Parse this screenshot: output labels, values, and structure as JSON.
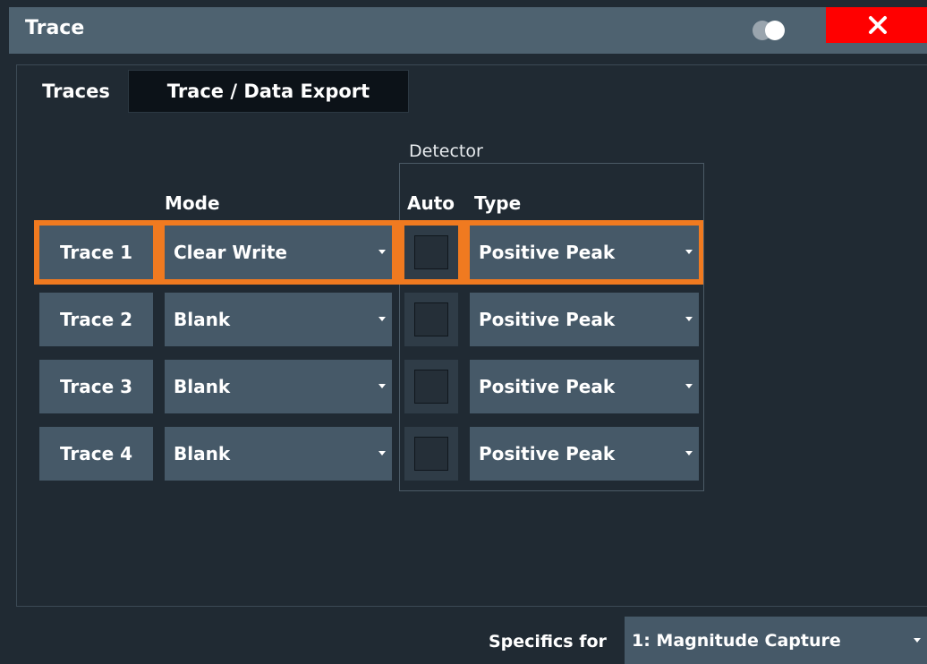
{
  "window": {
    "title": "Trace"
  },
  "tabs": [
    {
      "label": "Traces",
      "active": true
    },
    {
      "label": "Trace / Data Export",
      "active": false
    }
  ],
  "table": {
    "group_label": "Detector",
    "headers": {
      "mode": "Mode",
      "auto": "Auto",
      "type": "Type"
    },
    "rows": [
      {
        "trace": "Trace 1",
        "mode": "Clear Write",
        "auto": false,
        "type": "Positive Peak",
        "selected": true
      },
      {
        "trace": "Trace 2",
        "mode": "Blank",
        "auto": false,
        "type": "Positive Peak",
        "selected": false
      },
      {
        "trace": "Trace 3",
        "mode": "Blank",
        "auto": false,
        "type": "Positive Peak",
        "selected": false
      },
      {
        "trace": "Trace 4",
        "mode": "Blank",
        "auto": false,
        "type": "Positive Peak",
        "selected": false
      }
    ]
  },
  "footer": {
    "specifics_label": "Specifics for",
    "specifics_value": "1: Magnitude Capture"
  },
  "icons": {
    "toggle": "toggle-icon",
    "close": "close-icon",
    "dropdown": "chevron-down-icon"
  },
  "colors": {
    "background": "#202a33",
    "title_bar": "#4e6270",
    "control": "#465968",
    "highlight": "#f07a20",
    "close": "#ff0000"
  }
}
